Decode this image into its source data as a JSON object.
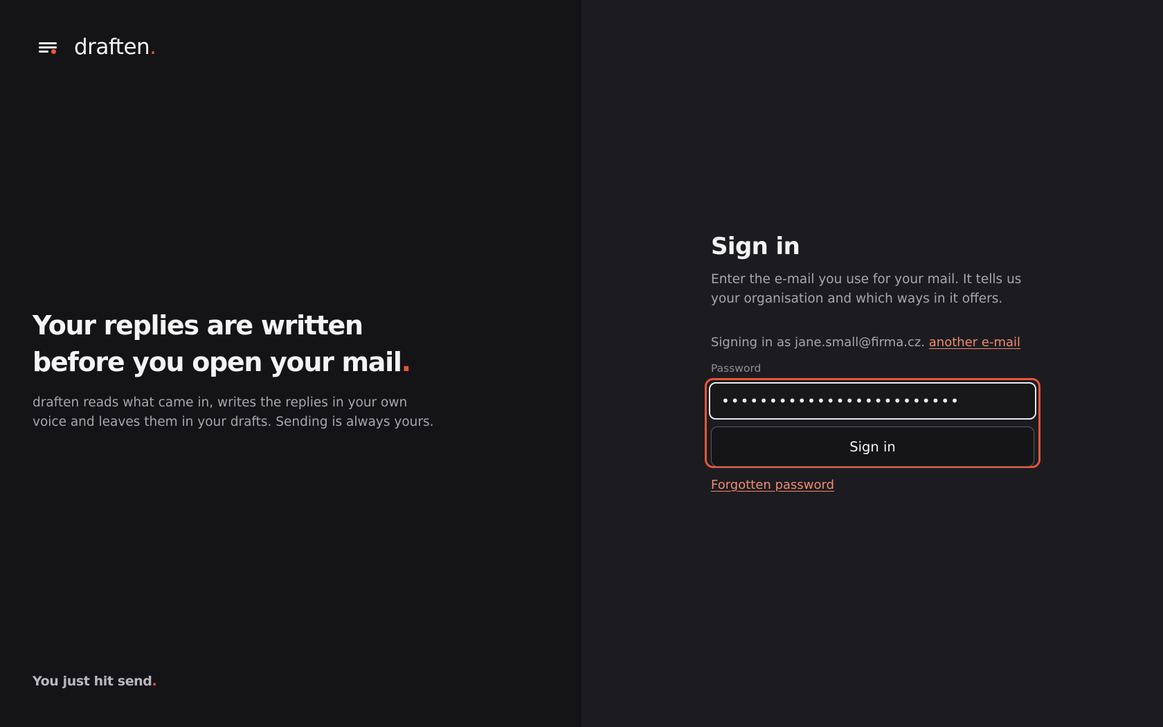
{
  "brand": {
    "name": "draften",
    "dot": ".",
    "accent_color": "#e8553a",
    "menu_icon": "menu-lines-icon"
  },
  "hero": {
    "title_main": "Your replies are written before you open your mail",
    "title_dot": ".",
    "subtitle": "draften reads what came in, writes the replies in your own voice and leaves them in your drafts. Sending is always yours."
  },
  "tagline": {
    "text": "You just hit send",
    "dot": "."
  },
  "signin": {
    "title": "Sign in",
    "description": "Enter the e-mail you use for your mail. It tells us your organisation and which ways in it offers.",
    "signing_as_prefix": "Signing in as jane.small@firma.cz.",
    "another_email_link": "another e-mail",
    "password_label": "Password",
    "password_value": "•••••••••••••••••••••••••",
    "submit_label": "Sign in",
    "forgot_link": "Forgotten password"
  }
}
